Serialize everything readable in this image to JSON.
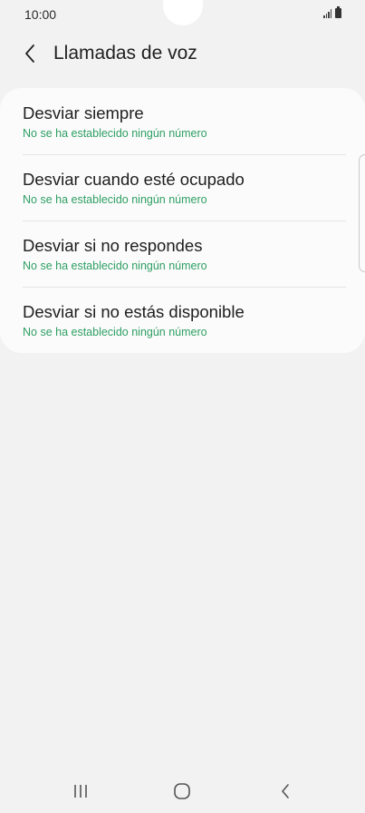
{
  "status_bar": {
    "time": "10:00",
    "icons": [
      "signal-icon",
      "battery-icon"
    ]
  },
  "header": {
    "back_icon": "chevron-left-icon",
    "title": "Llamadas de voz"
  },
  "forwarding_options": [
    {
      "title": "Desviar siempre",
      "subtitle": "No se ha establecido ningún número"
    },
    {
      "title": "Desviar cuando esté ocupado",
      "subtitle": "No se ha establecido ningún número"
    },
    {
      "title": "Desviar si no respondes",
      "subtitle": "No se ha establecido ningún número"
    },
    {
      "title": "Desviar si no estás disponible",
      "subtitle": "No se ha establecido ningún número"
    }
  ],
  "colors": {
    "background": "#f2f2f2",
    "card": "#fbfbfb",
    "subtitle_accent": "#2e9f63",
    "text": "#1e1e1e"
  },
  "nav_bar": {
    "icons": [
      "recent-apps-icon",
      "home-icon",
      "back-icon"
    ]
  }
}
